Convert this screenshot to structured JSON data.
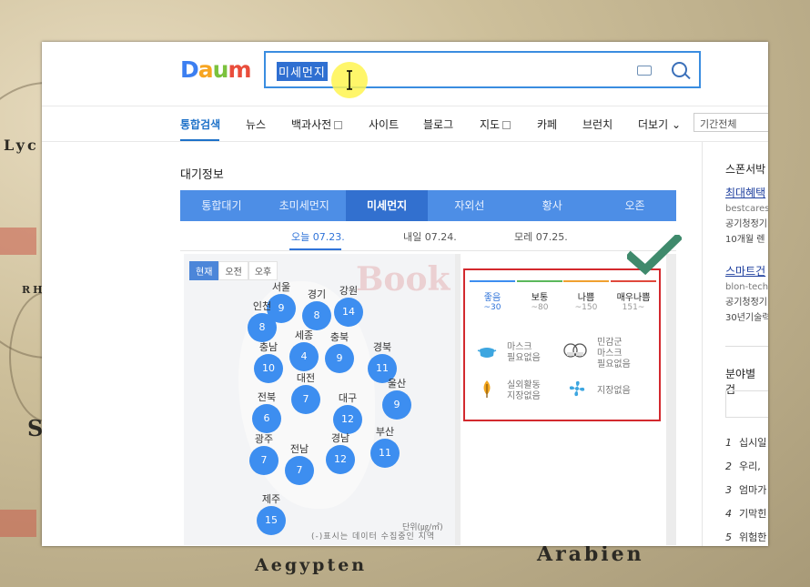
{
  "logo": [
    "D",
    "a",
    "u",
    "m"
  ],
  "search": {
    "query": "미세먼지"
  },
  "nav": {
    "items": [
      "통합검색",
      "뉴스",
      "백과사전",
      "사이트",
      "블로그",
      "지도",
      "카페",
      "브런치",
      "더보기"
    ],
    "period": "기간전체"
  },
  "section_title": "대기정보",
  "tabs": [
    "통합대기",
    "초미세먼지",
    "미세먼지",
    "자외선",
    "황사",
    "오존"
  ],
  "dates": [
    "오늘 07.23.",
    "내일 07.24.",
    "모레 07.25."
  ],
  "time_buttons": [
    "현재",
    "오전",
    "오후"
  ],
  "cities": [
    {
      "name": "서울",
      "value": "9"
    },
    {
      "name": "경기",
      "value": "8"
    },
    {
      "name": "강원",
      "value": "14"
    },
    {
      "name": "인천",
      "value": "8"
    },
    {
      "name": "충남",
      "value": "10"
    },
    {
      "name": "세종",
      "value": "4"
    },
    {
      "name": "충북",
      "value": "9"
    },
    {
      "name": "경북",
      "value": "11"
    },
    {
      "name": "대전",
      "value": "7"
    },
    {
      "name": "전북",
      "value": "6"
    },
    {
      "name": "대구",
      "value": "12"
    },
    {
      "name": "울산",
      "value": "9"
    },
    {
      "name": "광주",
      "value": "7"
    },
    {
      "name": "전남",
      "value": "7"
    },
    {
      "name": "경남",
      "value": "12"
    },
    {
      "name": "부산",
      "value": "11"
    },
    {
      "name": "제주",
      "value": "15"
    }
  ],
  "unit": "단위(㎍/㎥)",
  "note": "(-)표시는 데이터 수집중인 지역",
  "levels": [
    {
      "name": "좋음",
      "range": "~30",
      "color": "#3d8ef0"
    },
    {
      "name": "보통",
      "range": "~80",
      "color": "#5bb85c"
    },
    {
      "name": "나쁨",
      "range": "~150",
      "color": "#f0a030"
    },
    {
      "name": "매우나쁨",
      "range": "151~",
      "color": "#e0483c"
    }
  ],
  "info": {
    "mask": "마스크\n필요없음",
    "sensitive": "민감군\n마스크\n필요없음",
    "outdoor": "실외활동\n지장없음",
    "ventilation": "지장없음"
  },
  "sidebar": {
    "sponsor_title": "스폰서박",
    "ads": [
      {
        "title": "최대혜택",
        "url": "bestcares",
        "desc1": "공기청정기",
        "desc2": "10개월 렌"
      },
      {
        "title": "스마트건",
        "url": "blon-tech",
        "desc1": "공기청정기",
        "desc2": "30년기술력"
      }
    ],
    "category_title": "분야별 검",
    "ranks": [
      {
        "n": "1",
        "t": "십시일"
      },
      {
        "n": "2",
        "t": "우리, "
      },
      {
        "n": "3",
        "t": "엄마가"
      },
      {
        "n": "4",
        "t": "기막힌"
      },
      {
        "n": "5",
        "t": "위험한"
      }
    ]
  },
  "watermark": "Book",
  "map_labels": [
    "S",
    "Lyc",
    "RH",
    "Aegypten",
    "Arabien"
  ]
}
